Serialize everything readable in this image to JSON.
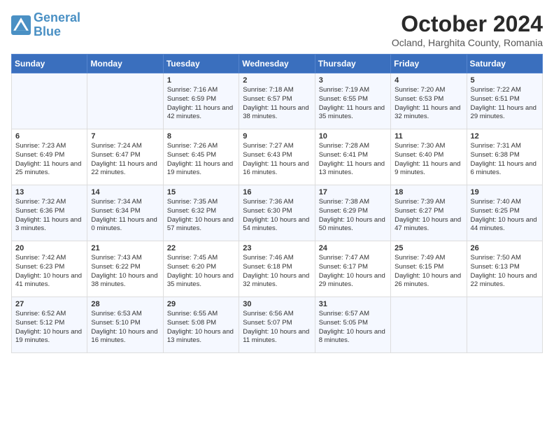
{
  "logo": {
    "line1": "General",
    "line2": "Blue"
  },
  "title": "October 2024",
  "subtitle": "Ocland, Harghita County, Romania",
  "days_header": [
    "Sunday",
    "Monday",
    "Tuesday",
    "Wednesday",
    "Thursday",
    "Friday",
    "Saturday"
  ],
  "weeks": [
    [
      {
        "day": "",
        "content": ""
      },
      {
        "day": "",
        "content": ""
      },
      {
        "day": "1",
        "content": "Sunrise: 7:16 AM\nSunset: 6:59 PM\nDaylight: 11 hours and 42 minutes."
      },
      {
        "day": "2",
        "content": "Sunrise: 7:18 AM\nSunset: 6:57 PM\nDaylight: 11 hours and 38 minutes."
      },
      {
        "day": "3",
        "content": "Sunrise: 7:19 AM\nSunset: 6:55 PM\nDaylight: 11 hours and 35 minutes."
      },
      {
        "day": "4",
        "content": "Sunrise: 7:20 AM\nSunset: 6:53 PM\nDaylight: 11 hours and 32 minutes."
      },
      {
        "day": "5",
        "content": "Sunrise: 7:22 AM\nSunset: 6:51 PM\nDaylight: 11 hours and 29 minutes."
      }
    ],
    [
      {
        "day": "6",
        "content": "Sunrise: 7:23 AM\nSunset: 6:49 PM\nDaylight: 11 hours and 25 minutes."
      },
      {
        "day": "7",
        "content": "Sunrise: 7:24 AM\nSunset: 6:47 PM\nDaylight: 11 hours and 22 minutes."
      },
      {
        "day": "8",
        "content": "Sunrise: 7:26 AM\nSunset: 6:45 PM\nDaylight: 11 hours and 19 minutes."
      },
      {
        "day": "9",
        "content": "Sunrise: 7:27 AM\nSunset: 6:43 PM\nDaylight: 11 hours and 16 minutes."
      },
      {
        "day": "10",
        "content": "Sunrise: 7:28 AM\nSunset: 6:41 PM\nDaylight: 11 hours and 13 minutes."
      },
      {
        "day": "11",
        "content": "Sunrise: 7:30 AM\nSunset: 6:40 PM\nDaylight: 11 hours and 9 minutes."
      },
      {
        "day": "12",
        "content": "Sunrise: 7:31 AM\nSunset: 6:38 PM\nDaylight: 11 hours and 6 minutes."
      }
    ],
    [
      {
        "day": "13",
        "content": "Sunrise: 7:32 AM\nSunset: 6:36 PM\nDaylight: 11 hours and 3 minutes."
      },
      {
        "day": "14",
        "content": "Sunrise: 7:34 AM\nSunset: 6:34 PM\nDaylight: 11 hours and 0 minutes."
      },
      {
        "day": "15",
        "content": "Sunrise: 7:35 AM\nSunset: 6:32 PM\nDaylight: 10 hours and 57 minutes."
      },
      {
        "day": "16",
        "content": "Sunrise: 7:36 AM\nSunset: 6:30 PM\nDaylight: 10 hours and 54 minutes."
      },
      {
        "day": "17",
        "content": "Sunrise: 7:38 AM\nSunset: 6:29 PM\nDaylight: 10 hours and 50 minutes."
      },
      {
        "day": "18",
        "content": "Sunrise: 7:39 AM\nSunset: 6:27 PM\nDaylight: 10 hours and 47 minutes."
      },
      {
        "day": "19",
        "content": "Sunrise: 7:40 AM\nSunset: 6:25 PM\nDaylight: 10 hours and 44 minutes."
      }
    ],
    [
      {
        "day": "20",
        "content": "Sunrise: 7:42 AM\nSunset: 6:23 PM\nDaylight: 10 hours and 41 minutes."
      },
      {
        "day": "21",
        "content": "Sunrise: 7:43 AM\nSunset: 6:22 PM\nDaylight: 10 hours and 38 minutes."
      },
      {
        "day": "22",
        "content": "Sunrise: 7:45 AM\nSunset: 6:20 PM\nDaylight: 10 hours and 35 minutes."
      },
      {
        "day": "23",
        "content": "Sunrise: 7:46 AM\nSunset: 6:18 PM\nDaylight: 10 hours and 32 minutes."
      },
      {
        "day": "24",
        "content": "Sunrise: 7:47 AM\nSunset: 6:17 PM\nDaylight: 10 hours and 29 minutes."
      },
      {
        "day": "25",
        "content": "Sunrise: 7:49 AM\nSunset: 6:15 PM\nDaylight: 10 hours and 26 minutes."
      },
      {
        "day": "26",
        "content": "Sunrise: 7:50 AM\nSunset: 6:13 PM\nDaylight: 10 hours and 22 minutes."
      }
    ],
    [
      {
        "day": "27",
        "content": "Sunrise: 6:52 AM\nSunset: 5:12 PM\nDaylight: 10 hours and 19 minutes."
      },
      {
        "day": "28",
        "content": "Sunrise: 6:53 AM\nSunset: 5:10 PM\nDaylight: 10 hours and 16 minutes."
      },
      {
        "day": "29",
        "content": "Sunrise: 6:55 AM\nSunset: 5:08 PM\nDaylight: 10 hours and 13 minutes."
      },
      {
        "day": "30",
        "content": "Sunrise: 6:56 AM\nSunset: 5:07 PM\nDaylight: 10 hours and 11 minutes."
      },
      {
        "day": "31",
        "content": "Sunrise: 6:57 AM\nSunset: 5:05 PM\nDaylight: 10 hours and 8 minutes."
      },
      {
        "day": "",
        "content": ""
      },
      {
        "day": "",
        "content": ""
      }
    ]
  ]
}
